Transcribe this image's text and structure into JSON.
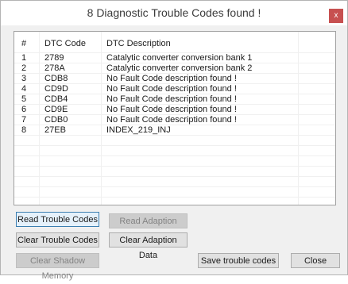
{
  "window": {
    "title": "8 Diagnostic Trouble Codes found !",
    "close_glyph": "x"
  },
  "list": {
    "columns": [
      "#",
      "DTC Code",
      "DTC Description"
    ],
    "rows": [
      {
        "num": "1",
        "code": "2789",
        "desc": "Catalytic converter conversion bank 1"
      },
      {
        "num": "2",
        "code": "278A",
        "desc": "Catalytic converter conversion bank 2"
      },
      {
        "num": "3",
        "code": "CDB8",
        "desc": "No Fault Code description found !"
      },
      {
        "num": "4",
        "code": "CD9D",
        "desc": "No Fault Code description found !"
      },
      {
        "num": "5",
        "code": "CDB4",
        "desc": "No Fault Code description found !"
      },
      {
        "num": "6",
        "code": "CD9E",
        "desc": "No Fault Code description found !"
      },
      {
        "num": "7",
        "code": "CDB0",
        "desc": "No Fault Code description found !"
      },
      {
        "num": "8",
        "code": "27EB",
        "desc": "INDEX_219_INJ"
      }
    ]
  },
  "buttons": {
    "read_trouble_codes": "Read Trouble Codes",
    "read_adaption_data": "Read Adaption Data",
    "clear_trouble_codes": "Clear Trouble Codes",
    "clear_adaption_data": "Clear Adaption Data",
    "clear_shadow_memory": "Clear Shadow Memory",
    "save_trouble_codes": "Save trouble codes",
    "close": "Close"
  },
  "colors": {
    "close_button_bg": "#c75050",
    "focus_border": "#3c7fb1",
    "disabled_text": "#838383"
  }
}
